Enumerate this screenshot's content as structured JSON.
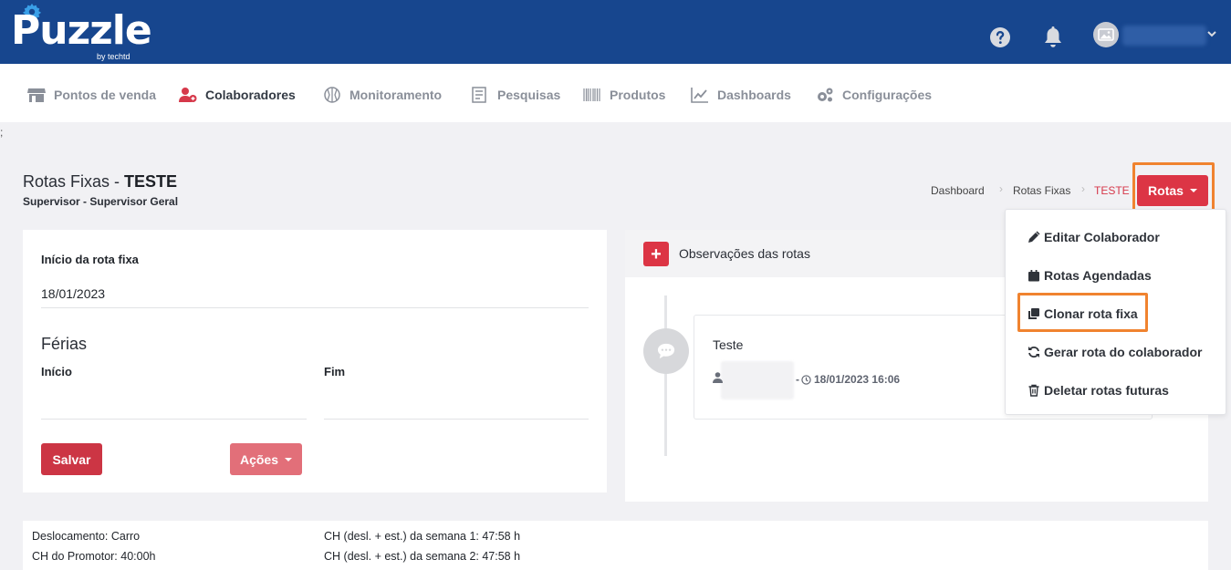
{
  "app": {
    "logo_text": "Puzzle",
    "logo_subtext": "by techtd"
  },
  "nav": {
    "items": [
      {
        "label": "Pontos de venda"
      },
      {
        "label": "Colaboradores"
      },
      {
        "label": "Monitoramento"
      },
      {
        "label": "Pesquisas"
      },
      {
        "label": "Produtos"
      },
      {
        "label": "Dashboards"
      },
      {
        "label": "Configurações"
      }
    ],
    "active": "Colaboradores"
  },
  "stray_text": ";",
  "page": {
    "title_prefix": "Rotas Fixas - ",
    "title_name": "TESTE",
    "subtitle": "Supervisor - Supervisor Geral"
  },
  "breadcrumb": {
    "items": [
      "Dashboard",
      "Rotas Fixas",
      "TESTE"
    ]
  },
  "rotas_button": {
    "label": "Rotas"
  },
  "dropdown": {
    "items": [
      {
        "label": "Editar Colaborador",
        "icon": "pencil-icon"
      },
      {
        "label": "Rotas Agendadas",
        "icon": "calendar-icon"
      },
      {
        "label": "Clonar rota fixa",
        "icon": "clone-icon"
      },
      {
        "label": "Gerar rota do colaborador",
        "icon": "refresh-icon"
      },
      {
        "label": "Deletar rotas futuras",
        "icon": "trash-icon"
      }
    ]
  },
  "form": {
    "start_label": "Início da rota fixa",
    "start_value": "18/01/2023",
    "ferias_title": "Férias",
    "inicio_label": "Início",
    "fim_label": "Fim",
    "save_label": "Salvar",
    "actions_label": "Ações"
  },
  "observations": {
    "title": "Observações das rotas",
    "add_symbol": "+",
    "note_text": "Teste",
    "note_date": "- ",
    "note_timestamp": "18/01/2023 16:06"
  },
  "summary": {
    "deslocamento": "Deslocamento: Carro",
    "ch_promotor": "CH do Promotor: 40:00h",
    "ch_semana1": "CH (desl. + est.) da semana 1: 47:58 h",
    "ch_semana2": "CH (desl. + est.) da semana 2: 47:58 h"
  },
  "colors": {
    "topbar": "#17468e",
    "accent_red": "#dc3545",
    "highlight_orange": "#f0832f"
  }
}
